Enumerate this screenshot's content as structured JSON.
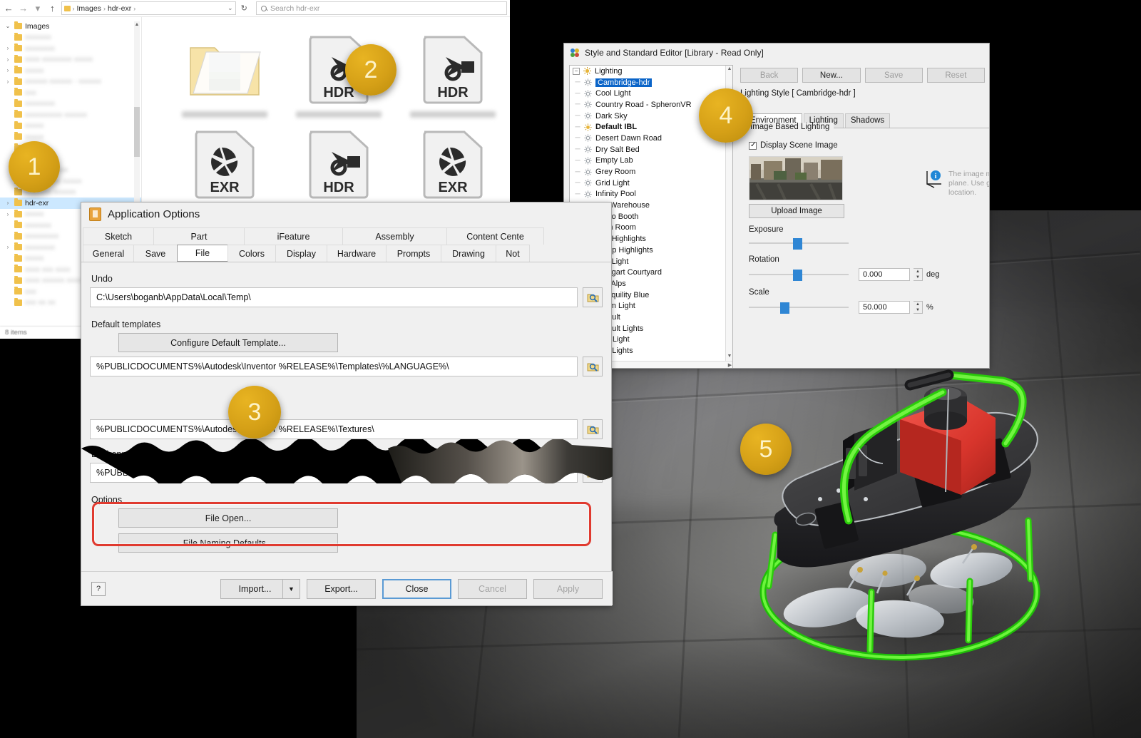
{
  "explorer": {
    "nav": {
      "back": "←",
      "forward": "→",
      "recent": "▾",
      "up": "↑"
    },
    "address": {
      "crumbs": [
        "Images",
        "hdr-exr"
      ],
      "caret": "⌄",
      "refresh": "↻"
    },
    "search": {
      "placeholder": "Search hdr-exr"
    },
    "tree_root": "Images",
    "tree_selected": "hdr-exr",
    "status": "8 items",
    "files": [
      {
        "kind": "folder-thumb",
        "label": ""
      },
      {
        "kind": "hdr",
        "label": "HDR"
      },
      {
        "kind": "hdr",
        "label": "HDR"
      },
      {
        "kind": "exr",
        "label": "EXR"
      },
      {
        "kind": "hdr",
        "label": "HDR"
      },
      {
        "kind": "exr",
        "label": "EXR"
      }
    ]
  },
  "badges": [
    {
      "num": "1"
    },
    {
      "num": "2"
    },
    {
      "num": "3"
    },
    {
      "num": "4"
    },
    {
      "num": "5"
    }
  ],
  "app_options": {
    "title": "Application Options",
    "tabs_row1": [
      "Sketch",
      "Part",
      "iFeature",
      "Assembly",
      "Content Cente"
    ],
    "tabs_row2": [
      "General",
      "Save",
      "File",
      "Colors",
      "Display",
      "Hardware",
      "Prompts",
      "Drawing",
      "Not"
    ],
    "selected_tab": "File",
    "undo_label": "Undo",
    "undo_path": "C:\\Users\\boganb\\AppData\\Local\\Temp\\",
    "default_templates_label": "Default templates",
    "configure_template_button": "Configure Default Template...",
    "templates_path": "%PUBLICDOCUMENTS%\\Autodesk\\Inventor %RELEASE%\\Templates\\%LANGUAGE%\\",
    "textures_path": "%PUBLICDOCUMENTS%\\Autodesk\\Inventor %RELEASE%\\Textures\\",
    "environment_label": "Environment folder",
    "environment_path": "%PUBLICDOCUMENTS%\\Autodesk\\Inventor %RELEASE%\\Environments\\",
    "options_label": "Options",
    "file_open_button": "File Open...",
    "file_naming_button": "File Naming Defaults...",
    "help_button": "?",
    "footer_buttons": [
      "Import...",
      "Export...",
      "Close",
      "Cancel",
      "Apply"
    ],
    "import_split_arrow": "▼",
    "highlight_color": "#e03a2f"
  },
  "style_editor": {
    "title": "Style and Standard Editor [Library - Read Only]",
    "tree_root": "Lighting",
    "tree_selected": "Cambridge-hdr",
    "tree_items": [
      {
        "label": "Cambridge-hdr",
        "icon": "sun-icon",
        "selected": true,
        "bold": false
      },
      {
        "label": "Cool Light",
        "icon": "sun-icon",
        "selected": false,
        "bold": false
      },
      {
        "label": "Country Road - SpheronVR",
        "icon": "sun-icon",
        "selected": false,
        "bold": false
      },
      {
        "label": "Dark Sky",
        "icon": "sun-icon",
        "selected": false,
        "bold": false
      },
      {
        "label": "Default IBL",
        "icon": "sun-icon",
        "selected": false,
        "bold": true
      },
      {
        "label": "Desert Dawn Road",
        "icon": "sun-icon",
        "selected": false,
        "bold": false
      },
      {
        "label": "Dry Salt Bed",
        "icon": "sun-icon",
        "selected": false,
        "bold": false
      },
      {
        "label": "Empty Lab",
        "icon": "sun-icon",
        "selected": false,
        "bold": false
      },
      {
        "label": "Grey Room",
        "icon": "sun-icon",
        "selected": false,
        "bold": false
      },
      {
        "label": "Grid Light",
        "icon": "sun-icon",
        "selected": false,
        "bold": false
      },
      {
        "label": "Infinity Pool",
        "icon": "sun-icon",
        "selected": false,
        "bold": false
      },
      {
        "label": "Old Warehouse",
        "icon": "sun-icon",
        "selected": false,
        "bold": false
      },
      {
        "label": "Photo Booth",
        "icon": "sun-icon",
        "selected": false,
        "bold": false
      },
      {
        "label": "Plain Room",
        "icon": "sun-icon",
        "selected": false,
        "bold": false
      },
      {
        "label": "Rim Highlights",
        "icon": "sun-icon",
        "selected": false,
        "bold": false
      },
      {
        "label": "Sharp Highlights",
        "icon": "sun-icon",
        "selected": false,
        "bold": false
      },
      {
        "label": "Soft Light",
        "icon": "sun-icon",
        "selected": false,
        "bold": false
      },
      {
        "label": "Stuttgart Courtyard",
        "icon": "sun-icon",
        "selected": false,
        "bold": false
      },
      {
        "label": "The Alps",
        "icon": "sun-icon",
        "selected": false,
        "bold": false
      },
      {
        "label": "Tranquility Blue",
        "icon": "sun-icon",
        "selected": false,
        "bold": false
      },
      {
        "label": "Warm Light",
        "icon": "sun-icon",
        "selected": false,
        "bold": false
      },
      {
        "label": "Default",
        "icon": "bulb-icon",
        "selected": false,
        "bold": false
      },
      {
        "label": "Default Lights",
        "icon": "bulb-icon",
        "selected": false,
        "bold": false
      },
      {
        "label": "One Light",
        "icon": "bulb-icon",
        "selected": false,
        "bold": false
      },
      {
        "label": "Two Lights",
        "icon": "bulb-icon",
        "selected": false,
        "bold": false
      }
    ],
    "top_buttons": [
      {
        "label": "Back",
        "enabled": false
      },
      {
        "label": "New...",
        "enabled": true
      },
      {
        "label": "Save",
        "enabled": false
      },
      {
        "label": "Reset",
        "enabled": false
      }
    ],
    "style_name": "Lighting Style [ Cambridge-hdr ]",
    "sub_tabs": [
      "Environment",
      "Lighting",
      "Shadows"
    ],
    "selected_sub_tab": "Environment",
    "ibl_group_label": "Image Based Lighting",
    "display_scene_image_label": "Display Scene Image",
    "display_scene_image_checked": true,
    "upload_image_button": "Upload Image",
    "exposure_label": "Exposure",
    "rotation_label": "Rotation",
    "rotation_value": "0.000",
    "rotation_unit": "deg",
    "scale_label": "Scale",
    "scale_value": "50.000",
    "scale_unit": "%",
    "info_text": "The image model loca plane. Use ground plan location."
  }
}
